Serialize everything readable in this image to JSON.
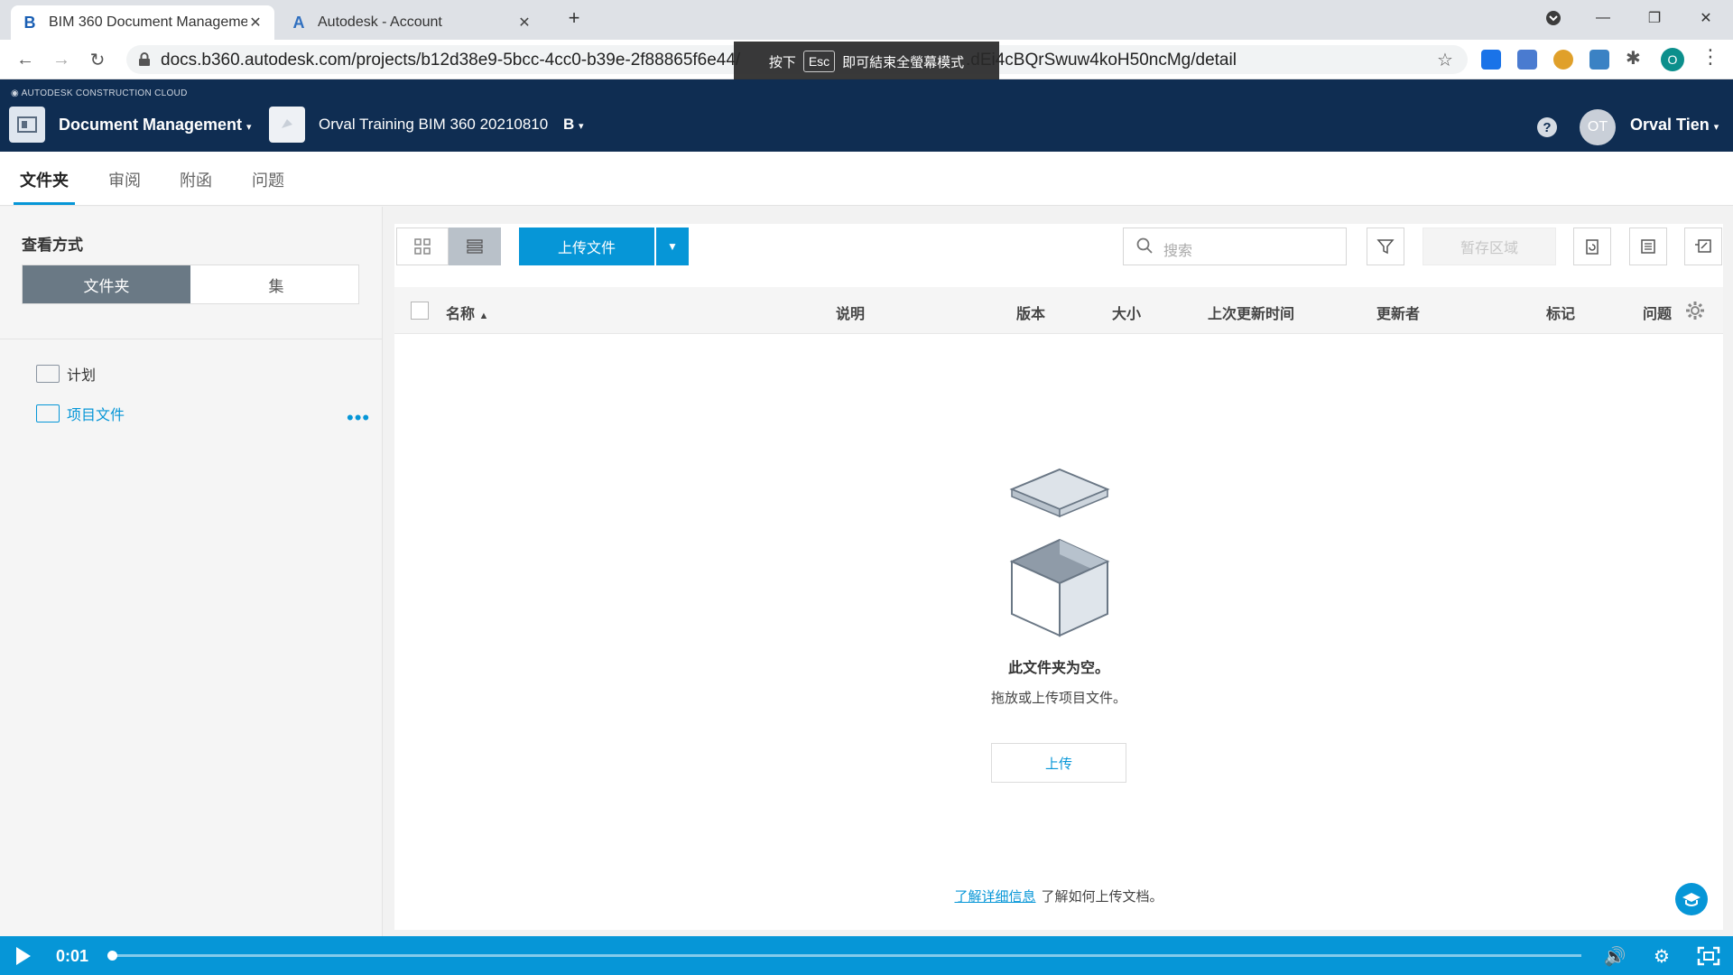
{
  "browser": {
    "tabs": [
      {
        "title": "BIM 360 Document Manageme",
        "favicon": "B",
        "active": true
      },
      {
        "title": "Autodesk - Account",
        "favicon": "A",
        "active": false
      }
    ],
    "url_visible_start": "docs.b360.autodesk.com/projects/b12d38e9-5bcc-4cc0-b39e-2f88865f6e44/",
    "url_visible_end": ".dEi4cBQrSwuw4koH50ncMg/detail",
    "profile_initial": "O",
    "esc_toast": {
      "before": "按下",
      "key": "Esc",
      "after": "即可結束全螢幕模式"
    }
  },
  "app_header": {
    "brand": "AUTODESK CONSTRUCTION CLOUD",
    "module": "Document Management",
    "project": "Orval Training BIM 360 20210810",
    "project_badge": "B",
    "user_initials": "OT",
    "user_name": "Orval Tien"
  },
  "subtabs": [
    "文件夹",
    "审阅",
    "附函",
    "问题"
  ],
  "left_panel": {
    "view_label": "查看方式",
    "segments": [
      "文件夹",
      "集"
    ],
    "tree": [
      {
        "label": "计划",
        "selected": false
      },
      {
        "label": "项目文件",
        "selected": true
      }
    ]
  },
  "toolbar": {
    "upload_label": "上传文件",
    "search_placeholder": "搜索",
    "staging_label": "暂存区域"
  },
  "table": {
    "columns": [
      "名称",
      "说明",
      "版本",
      "大小",
      "上次更新时间",
      "更新者",
      "标记",
      "问题"
    ]
  },
  "empty_state": {
    "title": "此文件夹为空。",
    "subtitle": "拖放或上传项目文件。",
    "upload_button": "上传",
    "learn_link": "了解详细信息",
    "learn_text": "了解如何上传文档。"
  },
  "video": {
    "time": "0:01",
    "progress": 0.001
  },
  "colors": {
    "header_bg": "#0f2d52",
    "accent": "#0696d7"
  }
}
